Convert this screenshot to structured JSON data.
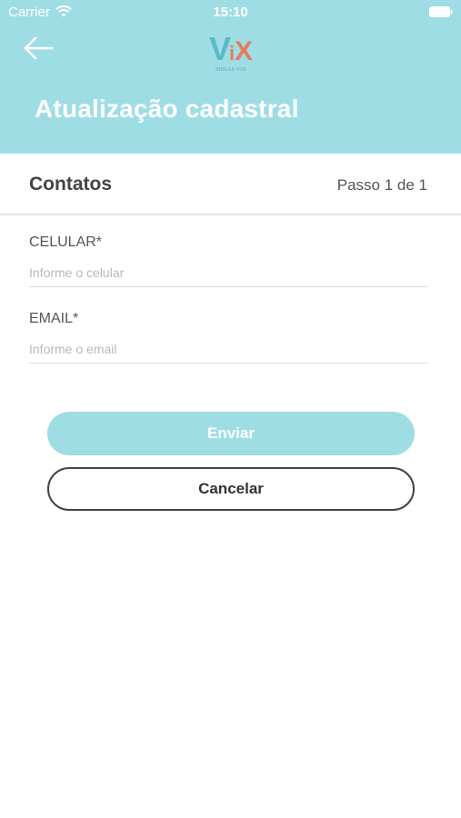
{
  "status_bar": {
    "carrier": "Carrier",
    "time": "15:10",
    "wifi_icon": "wifi-icon",
    "battery_icon": "battery-icon"
  },
  "header": {
    "back_icon": "arrow-left-icon",
    "logo": {
      "text": "ViX",
      "subtitle": "MINAS VIX"
    },
    "title": "Atualização cadastral"
  },
  "section": {
    "title": "Contatos",
    "step": "Passo 1 de 1"
  },
  "form": {
    "fields": [
      {
        "label": "CELULAR*",
        "placeholder": "Informe o celular",
        "value": ""
      },
      {
        "label": "EMAIL*",
        "placeholder": "Informe o email",
        "value": ""
      }
    ]
  },
  "buttons": {
    "submit": "Enviar",
    "cancel": "Cancelar"
  },
  "colors": {
    "accent": "#9fdde5",
    "text_dark": "#444444"
  }
}
